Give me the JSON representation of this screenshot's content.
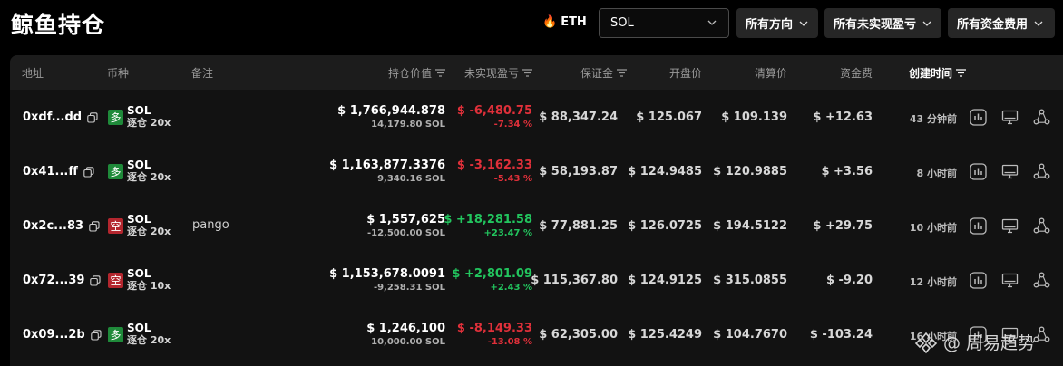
{
  "page": {
    "title": "鲸鱼持仓"
  },
  "filters": {
    "eth_label": "ETH",
    "symbol_select": "SOL",
    "direction_select": "所有方向",
    "pnl_select": "所有未实现盈亏",
    "funding_select": "所有资金费用"
  },
  "columns": {
    "address": "地址",
    "coin": "币种",
    "note": "备注",
    "position_value": "持仓价值",
    "unrealized_pnl": "未实现盈亏",
    "margin": "保证金",
    "open_price": "开盘价",
    "liq_price": "清算价",
    "funding": "资金费",
    "created": "创建时间"
  },
  "rows": [
    {
      "address": "0xdf...dd",
      "side_label": "多",
      "side": "long",
      "coin": "SOL",
      "mode": "逐仓 20x",
      "note": "",
      "value": "$ 1,766,944.878",
      "size": "14,179.80 SOL",
      "pnl": "$ -6,480.75",
      "pnl_pct": "-7.34 %",
      "pnl_sign": "neg",
      "margin": "$ 88,347.24",
      "open": "$ 125.067",
      "liq": "$ 109.139",
      "funding": "$ +12.63",
      "funding_sign": "pos",
      "time": "43 分钟前"
    },
    {
      "address": "0x41...ff",
      "side_label": "多",
      "side": "long",
      "coin": "SOL",
      "mode": "逐仓 20x",
      "note": "",
      "value": "$ 1,163,877.3376",
      "size": "9,340.16 SOL",
      "pnl": "$ -3,162.33",
      "pnl_pct": "-5.43 %",
      "pnl_sign": "neg",
      "margin": "$ 58,193.87",
      "open": "$ 124.9485",
      "liq": "$ 120.9885",
      "funding": "$ +3.56",
      "funding_sign": "pos",
      "time": "8 小时前"
    },
    {
      "address": "0x2c...83",
      "side_label": "空",
      "side": "short",
      "coin": "SOL",
      "mode": "逐仓 20x",
      "note": "pango",
      "value": "$ 1,557,625",
      "size": "-12,500.00 SOL",
      "pnl": "$ +18,281.58",
      "pnl_pct": "+23.47 %",
      "pnl_sign": "pos",
      "margin": "$ 77,881.25",
      "open": "$ 126.0725",
      "liq": "$ 194.5122",
      "funding": "$ +29.75",
      "funding_sign": "pos",
      "time": "10 小时前"
    },
    {
      "address": "0x72...39",
      "side_label": "空",
      "side": "short",
      "coin": "SOL",
      "mode": "逐仓 10x",
      "note": "",
      "value": "$ 1,153,678.0091",
      "size": "-9,258.31 SOL",
      "pnl": "$ +2,801.09",
      "pnl_pct": "+2.43 %",
      "pnl_sign": "pos",
      "margin": "$ 115,367.80",
      "open": "$ 124.9125",
      "liq": "$ 315.0855",
      "funding": "$ -9.20",
      "funding_sign": "neg",
      "time": "12 小时前"
    },
    {
      "address": "0x09...2b",
      "side_label": "多",
      "side": "long",
      "coin": "SOL",
      "mode": "逐仓 20x",
      "note": "",
      "value": "$ 1,246,100",
      "size": "10,000.00 SOL",
      "pnl": "$ -8,149.33",
      "pnl_pct": "-13.08 %",
      "pnl_sign": "neg",
      "margin": "$ 62,305.00",
      "open": "$ 125.4249",
      "liq": "$ 104.7670",
      "funding": "$ -103.24",
      "funding_sign": "neg",
      "time": "16 小时前"
    }
  ],
  "watermark": {
    "text": "@ 周易趋势"
  },
  "colors": {
    "positive": "#22c55e",
    "negative": "#e0303a",
    "long_badge": "#1f8a3a",
    "short_badge": "#b3262e"
  }
}
